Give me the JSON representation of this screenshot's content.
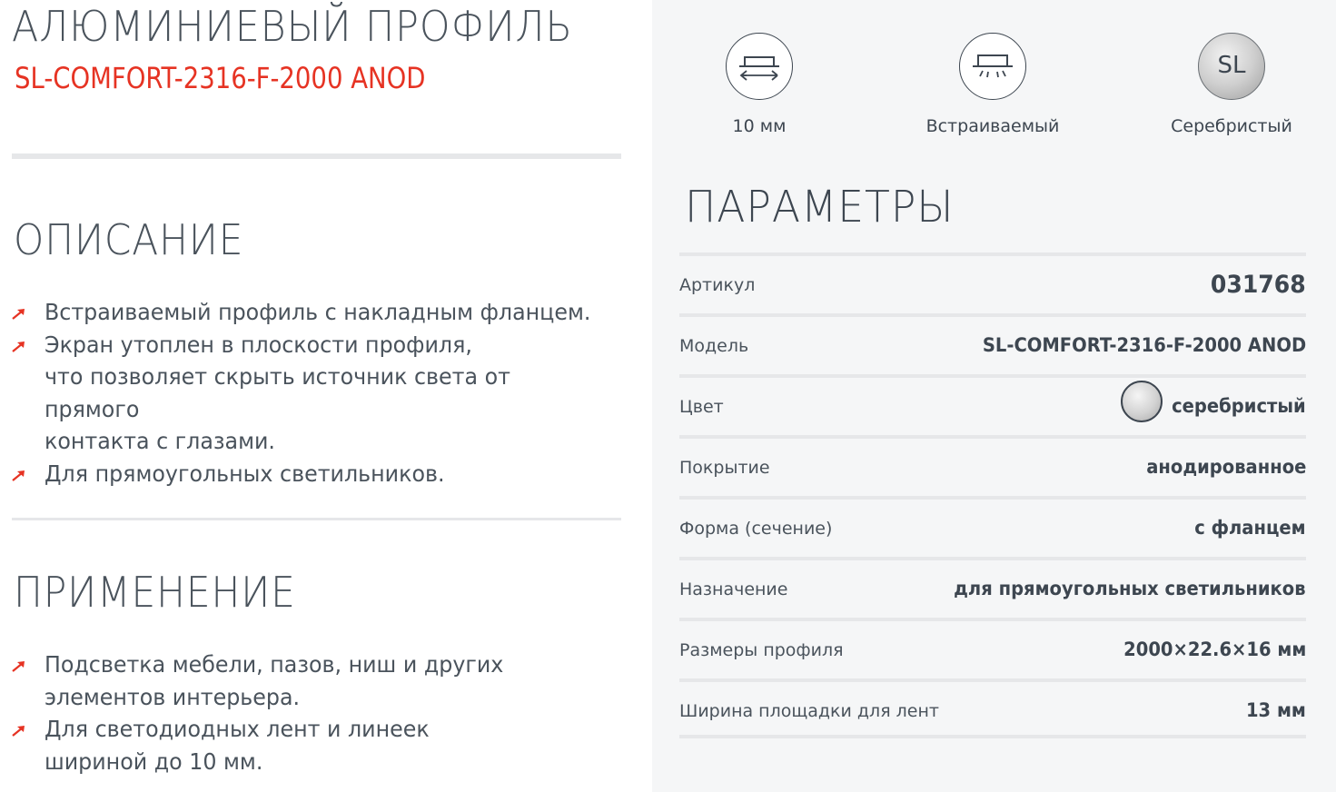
{
  "header": {
    "title": "АЛЮМИНИЕВЫЙ ПРОФИЛЬ",
    "subtitle": "SL-COMFORT-2316-F-2000 ANOD"
  },
  "description": {
    "heading": "ОПИСАНИЕ",
    "bullets": [
      "Встраиваемый профиль с накладным фланцем.",
      "Экран утоплен в плоскости профиля,",
      "что позволяет скрыть источник света от прямого",
      "контакта с глазами.",
      "Для прямоугольных светильников."
    ]
  },
  "application": {
    "heading": "ПРИМЕНЕНИЕ",
    "bullets": [
      "Подсветка мебели, пазов, ниш и других",
      "элементов интерьера.",
      "Для светодиодных лент и линеек",
      "шириной до 10 мм."
    ]
  },
  "features": [
    {
      "icon": "width-arrows-icon",
      "label": "10 мм"
    },
    {
      "icon": "built-in-light-icon",
      "label": "Встраиваемый"
    },
    {
      "icon": "silver-sl-icon",
      "badge": "SL",
      "label": "Серебристый"
    }
  ],
  "params": {
    "heading": "ПАРАМЕТРЫ",
    "rows": [
      {
        "key": "Артикул",
        "value": "031768"
      },
      {
        "key": "Модель",
        "value": "SL-COMFORT-2316-F-2000 ANOD"
      },
      {
        "key": "Цвет",
        "value": "серебристый"
      },
      {
        "key": "Покрытие",
        "value": "анодированное"
      },
      {
        "key": "Форма (сечение)",
        "value": "с фланцем"
      },
      {
        "key": "Назначение",
        "value": "для прямоугольных светильников"
      },
      {
        "key": "Размеры профиля",
        "value": "2000×22.6×16 мм"
      },
      {
        "key": "Ширина площадки для лент",
        "value": "13 мм"
      }
    ]
  },
  "colors": {
    "accent": "#e63323",
    "text": "#3d4650",
    "panel": "#f5f6f7",
    "divider": "#e6e7e9"
  }
}
